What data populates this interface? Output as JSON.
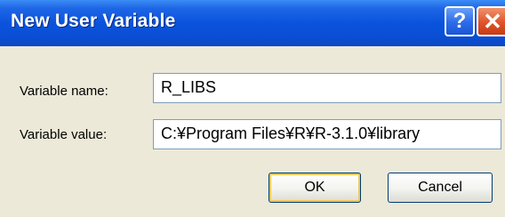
{
  "window": {
    "title": "New User Variable",
    "help_glyph": "?",
    "close_glyph": "✕"
  },
  "form": {
    "variable_name_label": "Variable name:",
    "variable_name_value": "R_LIBS",
    "variable_value_label": "Variable value:",
    "variable_value_value": "C:¥Program Files¥R¥R-3.1.0¥library"
  },
  "buttons": {
    "ok_label": "OK",
    "cancel_label": "Cancel"
  },
  "colors": {
    "titlebar_blue": "#0a53dd",
    "close_red": "#e0522a",
    "dialog_bg": "#ece9d8"
  }
}
